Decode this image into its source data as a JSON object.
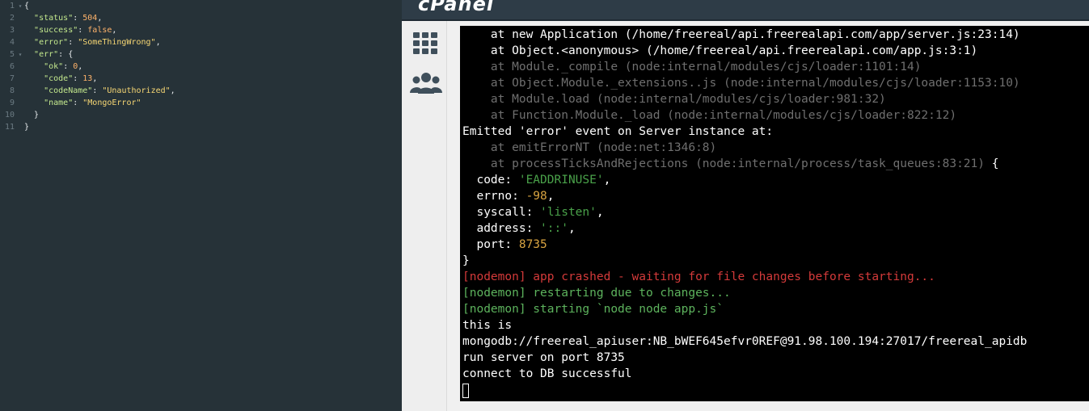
{
  "json_editor": {
    "lines": [
      {
        "num": "1",
        "fold": "▾",
        "parts": [
          [
            "p",
            "{"
          ]
        ]
      },
      {
        "num": "2",
        "fold": "",
        "parts": [
          [
            "p",
            "  "
          ],
          [
            "k",
            "\"status\""
          ],
          [
            "p",
            ": "
          ],
          [
            "n",
            "504"
          ],
          [
            "p",
            ","
          ]
        ]
      },
      {
        "num": "3",
        "fold": "",
        "parts": [
          [
            "p",
            "  "
          ],
          [
            "k",
            "\"success\""
          ],
          [
            "p",
            ": "
          ],
          [
            "b",
            "false"
          ],
          [
            "p",
            ","
          ]
        ]
      },
      {
        "num": "4",
        "fold": "",
        "parts": [
          [
            "p",
            "  "
          ],
          [
            "k",
            "\"error\""
          ],
          [
            "p",
            ": "
          ],
          [
            "s",
            "\"SomeThingWrong\""
          ],
          [
            "p",
            ","
          ]
        ]
      },
      {
        "num": "5",
        "fold": "▾",
        "parts": [
          [
            "p",
            "  "
          ],
          [
            "k",
            "\"err\""
          ],
          [
            "p",
            ": {"
          ]
        ]
      },
      {
        "num": "6",
        "fold": "",
        "parts": [
          [
            "p",
            "    "
          ],
          [
            "k",
            "\"ok\""
          ],
          [
            "p",
            ": "
          ],
          [
            "n",
            "0"
          ],
          [
            "p",
            ","
          ]
        ]
      },
      {
        "num": "7",
        "fold": "",
        "parts": [
          [
            "p",
            "    "
          ],
          [
            "k",
            "\"code\""
          ],
          [
            "p",
            ": "
          ],
          [
            "n",
            "13"
          ],
          [
            "p",
            ","
          ]
        ]
      },
      {
        "num": "8",
        "fold": "",
        "parts": [
          [
            "p",
            "    "
          ],
          [
            "k",
            "\"codeName\""
          ],
          [
            "p",
            ": "
          ],
          [
            "s",
            "\"Unauthorized\""
          ],
          [
            "p",
            ","
          ]
        ]
      },
      {
        "num": "9",
        "fold": "",
        "parts": [
          [
            "p",
            "    "
          ],
          [
            "k",
            "\"name\""
          ],
          [
            "p",
            ": "
          ],
          [
            "s",
            "\"MongoError\""
          ]
        ]
      },
      {
        "num": "10",
        "fold": "",
        "parts": [
          [
            "p",
            "  }"
          ]
        ]
      },
      {
        "num": "11",
        "fold": "",
        "parts": [
          [
            "p",
            "}"
          ]
        ]
      }
    ]
  },
  "cpanel": {
    "logo": "cPanel",
    "sidebar": [
      {
        "name": "grid-icon"
      },
      {
        "name": "users-icon"
      }
    ]
  },
  "terminal": {
    "lines": [
      [
        [
          "white",
          "    at new Application (/home/freereal/api.freerealapi.com/app/server.js:23:14)"
        ]
      ],
      [
        [
          "white",
          "    at Object.<anonymous> (/home/freereal/api.freerealapi.com/app.js:3:1)"
        ]
      ],
      [
        [
          "gray",
          "    at Module._compile (node:internal/modules/cjs/loader:1101:14)"
        ]
      ],
      [
        [
          "gray",
          "    at Object.Module._extensions..js (node:internal/modules/cjs/loader:1153:10)"
        ]
      ],
      [
        [
          "gray",
          "    at Module.load (node:internal/modules/cjs/loader:981:32)"
        ]
      ],
      [
        [
          "gray",
          "    at Function.Module._load (node:internal/modules/cjs/loader:822:12)"
        ]
      ],
      [
        [
          "white",
          "Emitted 'error' event on Server instance at:"
        ]
      ],
      [
        [
          "gray",
          "    at emitErrorNT (node:net:1346:8)"
        ]
      ],
      [
        [
          "gray",
          "    at processTicksAndRejections (node:internal/process/task_queues:83:21)"
        ],
        [
          "white",
          " {"
        ]
      ],
      [
        [
          "white",
          "  code: "
        ],
        [
          "green",
          "'EADDRINUSE'"
        ],
        [
          "white",
          ","
        ]
      ],
      [
        [
          "white",
          "  errno: "
        ],
        [
          "yellow",
          "-98"
        ],
        [
          "white",
          ","
        ]
      ],
      [
        [
          "white",
          "  syscall: "
        ],
        [
          "green",
          "'listen'"
        ],
        [
          "white",
          ","
        ]
      ],
      [
        [
          "white",
          "  address: "
        ],
        [
          "green",
          "'::'"
        ],
        [
          "white",
          ","
        ]
      ],
      [
        [
          "white",
          "  port: "
        ],
        [
          "yellow",
          "8735"
        ]
      ],
      [
        [
          "white",
          "}"
        ]
      ],
      [
        [
          "red",
          "[nodemon] app crashed - waiting for file changes before starting..."
        ]
      ],
      [
        [
          "lgreen",
          "[nodemon] restarting due to changes..."
        ]
      ],
      [
        [
          "lgreen",
          "[nodemon] starting `node node app.js`"
        ]
      ],
      [
        [
          "white",
          "this is"
        ]
      ],
      [
        [
          "white",
          "mongodb://freereal_apiuser:NB_bWEF645efvr0REF@91.98.100.194:27017/freereal_apidb"
        ]
      ],
      [
        [
          "white",
          "run server on port 8735"
        ]
      ],
      [
        [
          "white",
          "connect to DB successful"
        ]
      ]
    ]
  },
  "colors": {
    "editor_bg": "#263238",
    "header_bg": "#2e3c47",
    "terminal_bg": "#000000"
  }
}
